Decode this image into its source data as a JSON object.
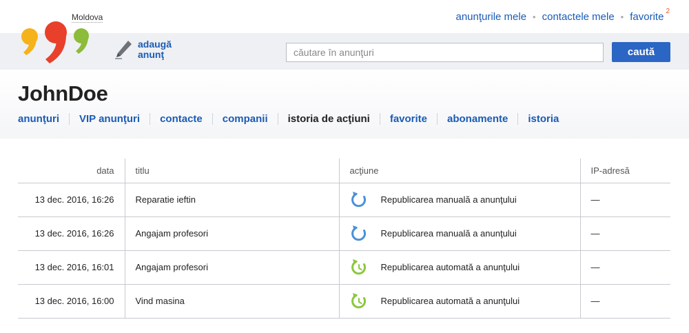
{
  "header": {
    "region": "Moldova",
    "links": {
      "my_ads": "anunţurile mele",
      "my_contacts": "contactele mele",
      "favorites": "favorite",
      "favorites_count": "2"
    },
    "add_ad_label": "adaugă anunţ",
    "search": {
      "placeholder": "căutare în anunţuri",
      "button_label": "caută"
    }
  },
  "profile": {
    "username": "JohnDoe",
    "tabs": [
      {
        "label": "anunţuri",
        "active": false
      },
      {
        "label": "VIP anunţuri",
        "active": false
      },
      {
        "label": "contacte",
        "active": false
      },
      {
        "label": "companii",
        "active": false
      },
      {
        "label": "istoria de acţiuni",
        "active": true
      },
      {
        "label": "favorite",
        "active": false
      },
      {
        "label": "abonamente",
        "active": false
      },
      {
        "label": "istoria",
        "active": false
      }
    ]
  },
  "table": {
    "headers": {
      "date": "data",
      "title": "titlu",
      "action": "acţiune",
      "ip": "IP-adresă"
    },
    "rows": [
      {
        "date": "13 dec. 2016, 16:26",
        "title": "Reparatie ieftin",
        "action": "Republicarea manuală a anunţului",
        "action_icon": "manual-refresh-icon",
        "ip": "—"
      },
      {
        "date": "13 dec. 2016, 16:26",
        "title": "Angajam profesori",
        "action": "Republicarea manuală a anunţului",
        "action_icon": "manual-refresh-icon",
        "ip": "—"
      },
      {
        "date": "13 dec. 2016, 16:01",
        "title": "Angajam profesori",
        "action": "Republicarea automată a anunţului",
        "action_icon": "auto-refresh-icon",
        "ip": "—"
      },
      {
        "date": "13 dec. 2016, 16:00",
        "title": "Vind masina",
        "action": "Republicarea automată a anunţului",
        "action_icon": "auto-refresh-icon",
        "ip": "—"
      }
    ]
  },
  "colors": {
    "link": "#1a5bb5",
    "search_button": "#2c66c4",
    "manual_icon": "#4a90d9",
    "auto_icon": "#8cc63f",
    "logo_yellow": "#f6b21a",
    "logo_red": "#e8402a",
    "logo_green": "#8dbb3a"
  }
}
